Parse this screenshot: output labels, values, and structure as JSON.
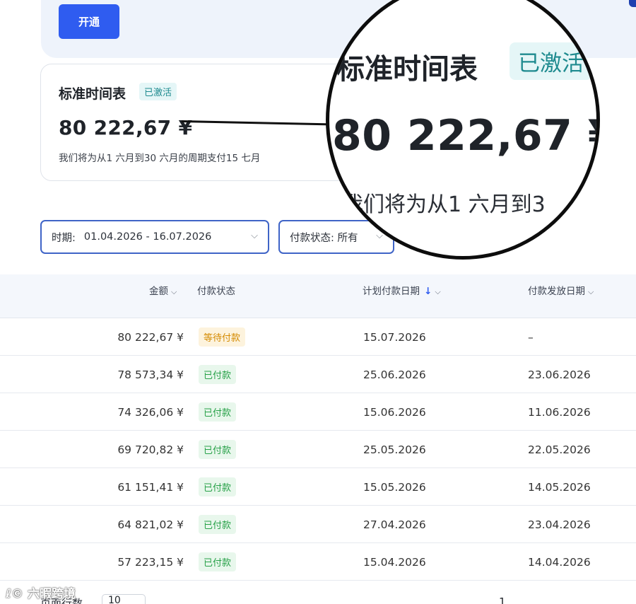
{
  "header": {
    "open_button": "开通"
  },
  "schedule_card": {
    "title": "标准时间表",
    "badge": "已激活",
    "amount": "80 222,67 ¥",
    "description": "我们将为从1 六月到30 六月的周期支付15 七月"
  },
  "zoom": {
    "title": "标准时间表",
    "badge": "已激活",
    "amount": "80 222,67 ¥",
    "description": "我们将为从1 六月到3"
  },
  "filters": {
    "period_label": "时期:",
    "period_value": "01.04.2026 - 16.07.2026",
    "status_label": "付款状态: 所有"
  },
  "table": {
    "headers": {
      "amount": "金额",
      "status": "付款状态",
      "planned_date": "计划付款日期",
      "released_date": "付款发放日期"
    },
    "rows": [
      {
        "amount": "80 222,67 ¥",
        "status": "等待付款",
        "status_kind": "waiting",
        "planned": "15.07.2026",
        "released": "–"
      },
      {
        "amount": "78 573,34 ¥",
        "status": "已付款",
        "status_kind": "paid",
        "planned": "25.06.2026",
        "released": "23.06.2026"
      },
      {
        "amount": "74 326,06 ¥",
        "status": "已付款",
        "status_kind": "paid",
        "planned": "15.06.2026",
        "released": "11.06.2026"
      },
      {
        "amount": "69 720,82 ¥",
        "status": "已付款",
        "status_kind": "paid",
        "planned": "25.05.2026",
        "released": "22.05.2026"
      },
      {
        "amount": "61 151,41 ¥",
        "status": "已付款",
        "status_kind": "paid",
        "planned": "15.05.2026",
        "released": "14.05.2026"
      },
      {
        "amount": "64 821,02 ¥",
        "status": "已付款",
        "status_kind": "paid",
        "planned": "27.04.2026",
        "released": "23.04.2026"
      },
      {
        "amount": "57 223,15 ¥",
        "status": "已付款",
        "status_kind": "paid",
        "planned": "15.04.2026",
        "released": "14.04.2026"
      }
    ]
  },
  "footer": {
    "rows_per_page_label": "页面行数",
    "rows_per_page_value": "10",
    "page_number": "1"
  },
  "watermark": "六暇跨境",
  "colors": {
    "primary": "#2f5cf0",
    "paid_text": "#27a148",
    "waiting_text": "#d48a00",
    "active_badge": "#1f8b8f"
  }
}
